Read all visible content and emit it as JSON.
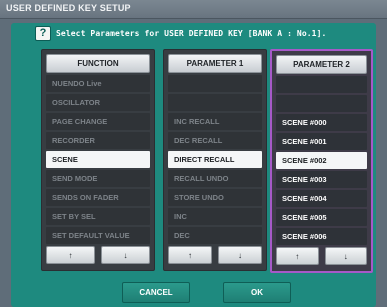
{
  "window": {
    "title": "USER DEFINED KEY SETUP"
  },
  "help_icon": "?",
  "prompt": "Select Parameters for USER DEFINED KEY [BANK A : No.1].",
  "columns": {
    "function": {
      "header": "FUNCTION",
      "items": [
        "NUENDO Live",
        "OSCILLATOR",
        "PAGE CHANGE",
        "RECORDER",
        "SCENE",
        "SEND MODE",
        "SENDS ON FADER",
        "SET BY SEL",
        "SET DEFAULT VALUE"
      ],
      "selected_index": 4
    },
    "parameter1": {
      "header": "PARAMETER 1",
      "items": [
        "",
        "",
        "INC RECALL",
        "DEC RECALL",
        "DIRECT RECALL",
        "RECALL UNDO",
        "STORE UNDO",
        "INC",
        "DEC"
      ],
      "selected_index": 4
    },
    "parameter2": {
      "header": "PARAMETER 2",
      "items": [
        "",
        "",
        "SCENE #000",
        "SCENE #001",
        "SCENE #002",
        "SCENE #003",
        "SCENE #004",
        "SCENE #005",
        "SCENE #006"
      ],
      "selected_index": 4
    }
  },
  "arrows": {
    "up": "↑",
    "down": "↓"
  },
  "buttons": {
    "cancel": "CANCEL",
    "ok": "OK"
  },
  "colors": {
    "panel": "#1e8a7f",
    "selection_frame": "#a659c8"
  }
}
